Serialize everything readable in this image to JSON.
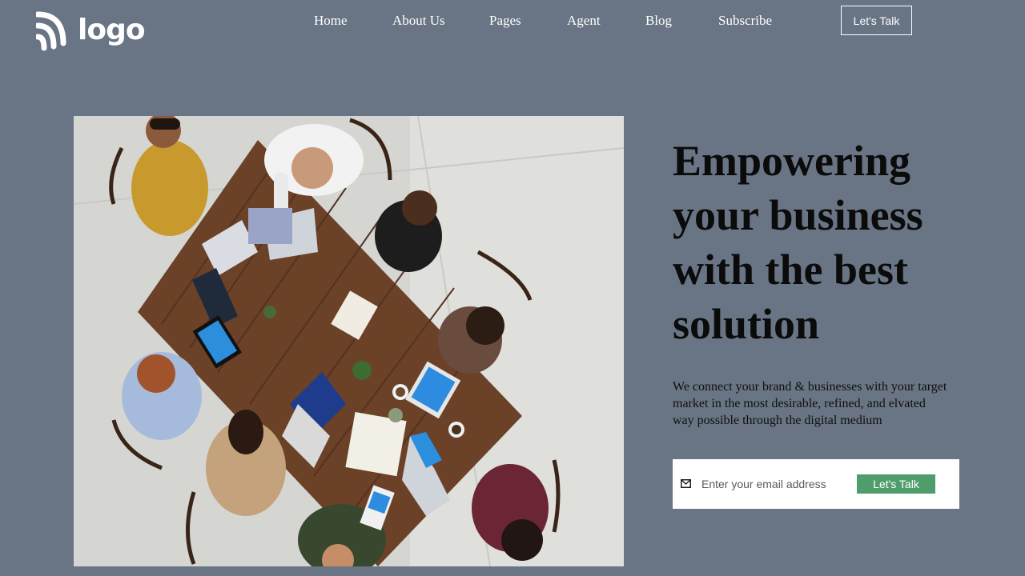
{
  "header": {
    "logo_text": "logo",
    "nav": [
      {
        "label": "Home"
      },
      {
        "label": "About Us"
      },
      {
        "label": "Pages"
      },
      {
        "label": "Agent"
      },
      {
        "label": "Blog"
      },
      {
        "label": "Subscribe"
      }
    ],
    "cta_label": "Let's Talk"
  },
  "hero": {
    "title": "Empowering your business with the best solution",
    "description": "We connect your brand & businesses with your target market in the most desirable, refined, and elvated way possible through the digital medium",
    "image_icon": "team-meeting-photo"
  },
  "subscribe": {
    "icon": "mail-icon",
    "placeholder": "Enter your email address",
    "button_label": "Let's Talk"
  },
  "colors": {
    "background": "#697584",
    "accent_button": "#4f9d6b",
    "text_dark": "#0b0b0b",
    "header_text": "#ffffff"
  }
}
